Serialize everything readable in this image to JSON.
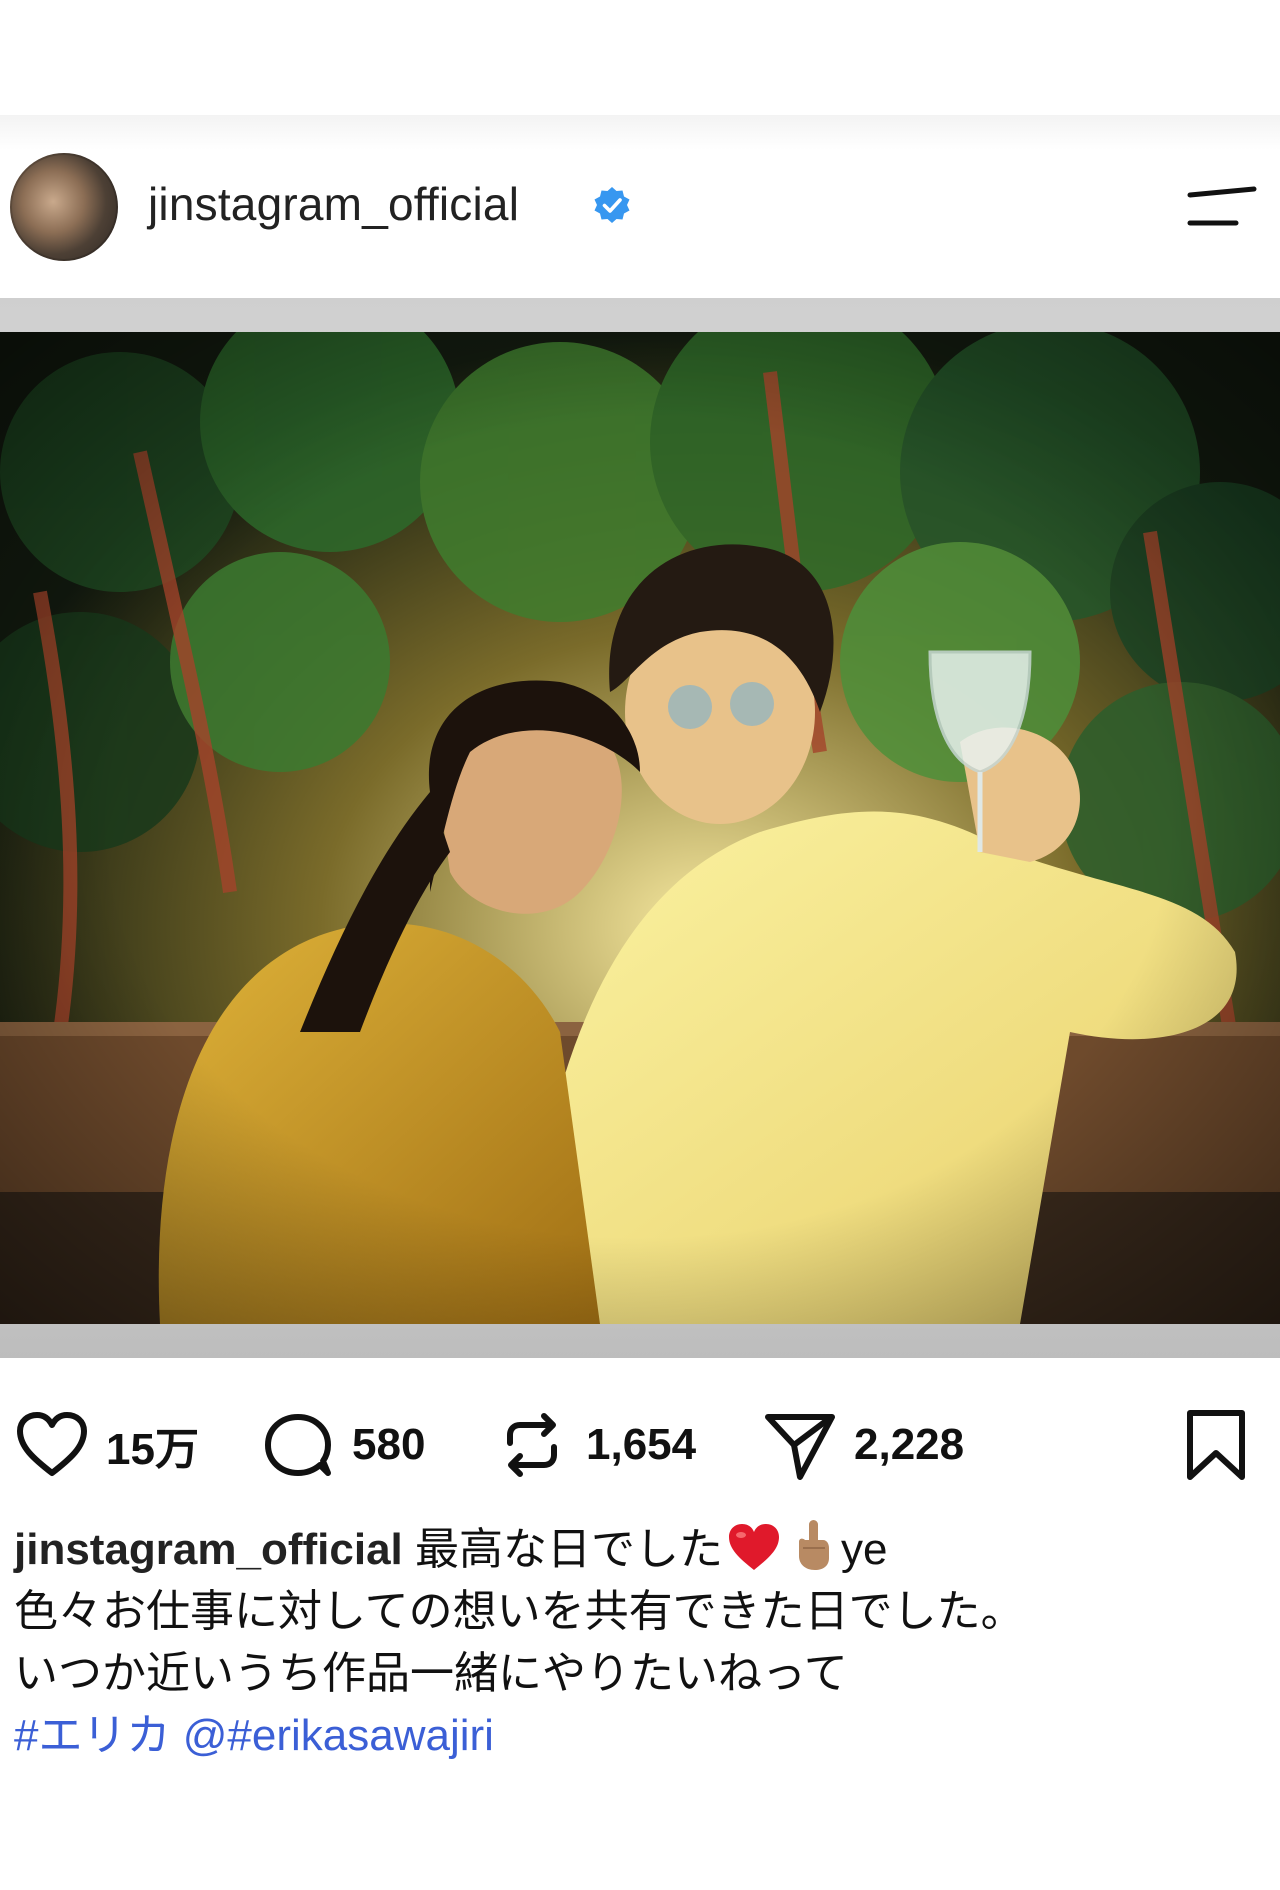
{
  "post": {
    "username": "jinstagram_official",
    "verified": true
  },
  "photo": {
    "description_icon": "photo"
  },
  "actions": {
    "likes": "15万",
    "comments": "580",
    "reposts": "1,654",
    "shares": "2,228"
  },
  "caption": {
    "username": "jinstagram_official",
    "line1_text": "最高な日でした",
    "line1_tail": "ye",
    "line2": "色々お仕事に対しての想いを共有できた日でした。",
    "line3": "いつか近いうち作品一緒にやりたいねって",
    "hashtag": "#エリカ",
    "mention": "@#erikasawajiri"
  },
  "colors": {
    "verified_blue": "#3797f0",
    "link_blue": "#3b5fd6",
    "heart_red": "#e0192b"
  }
}
